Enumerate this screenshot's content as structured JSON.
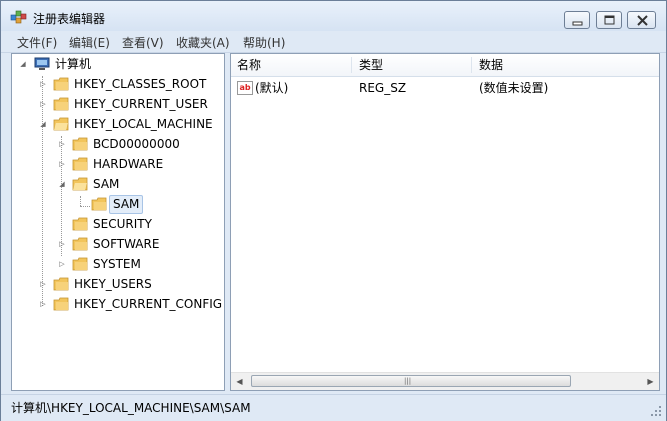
{
  "window": {
    "title": "注册表编辑器"
  },
  "menu": [
    {
      "label": "文件(F)"
    },
    {
      "label": "编辑(E)"
    },
    {
      "label": "查看(V)"
    },
    {
      "label": "收藏夹(A)"
    },
    {
      "label": "帮助(H)"
    }
  ],
  "tree": {
    "root": "计算机",
    "nodes": [
      {
        "label": "HKEY_CLASSES_ROOT"
      },
      {
        "label": "HKEY_CURRENT_USER"
      },
      {
        "label": "HKEY_LOCAL_MACHINE"
      },
      {
        "label": "BCD00000000"
      },
      {
        "label": "HARDWARE"
      },
      {
        "label": "SAM"
      },
      {
        "label": "SAM"
      },
      {
        "label": "SECURITY"
      },
      {
        "label": "SOFTWARE"
      },
      {
        "label": "SYSTEM"
      },
      {
        "label": "HKEY_USERS"
      },
      {
        "label": "HKEY_CURRENT_CONFIG"
      }
    ]
  },
  "list": {
    "columns": [
      "名称",
      "类型",
      "数据"
    ],
    "rows": [
      {
        "name": "(默认)",
        "type": "REG_SZ",
        "data": "(数值未设置)"
      }
    ]
  },
  "status": {
    "path": "计算机\\HKEY_LOCAL_MACHINE\\SAM\\SAM"
  },
  "icons": {
    "app": "registry-editor-icon",
    "computer": "computer-icon",
    "folder": "folder-icon",
    "value": "string-value-icon"
  },
  "colors": {
    "folder": "#f2c55c",
    "selection": "#e3edf9",
    "frame": "#dfe9f5"
  }
}
